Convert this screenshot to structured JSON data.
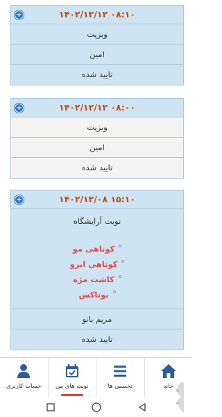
{
  "appointments": [
    {
      "datetime": "۰۸:۱۰ ۱۴۰۲/۱۲/۱۲",
      "rows": [
        "ویزیت",
        "امین",
        "تایید شده"
      ]
    },
    {
      "datetime": "۰۸:۰۰ ۱۴۰۲/۱۲/۱۲",
      "rows": [
        "ویزیت",
        "امین",
        "تایید شده"
      ]
    }
  ],
  "salon": {
    "datetime": "۱۵:۱۰ ۱۴۰۲/۱۲/۰۸",
    "title": "نوبت آرایشگاه",
    "services": [
      "کوتاهی مو",
      "کوتاهی ابرو",
      "کاشت مژه",
      "بوتاکس"
    ],
    "staff": "مریم بانو",
    "status": "تایید شده"
  },
  "nav": {
    "home": {
      "label": "خانه",
      "icon": "home-icon"
    },
    "specialties": {
      "label": "تخصص ها",
      "icon": "menu-lines-icon"
    },
    "my_appointments": {
      "label": "نوبت های من",
      "icon": "calendar-check-icon"
    },
    "account": {
      "label": "حساب کاربری",
      "icon": "user-icon"
    }
  },
  "colors": {
    "header_bg": "#cfe4f2",
    "date_text": "#bf4b12",
    "service_text": "#e04a4a",
    "accent": "#2b5c9b",
    "active_underline": "#d6453c"
  }
}
